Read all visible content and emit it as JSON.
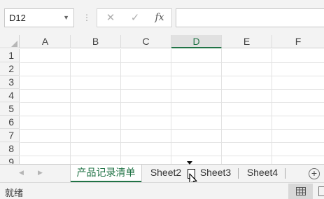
{
  "formula_bar": {
    "name_box": "D12",
    "cancel_icon": "✕",
    "enter_icon": "✓",
    "fx_label": "fx",
    "formula_value": ""
  },
  "grid": {
    "columns": [
      "A",
      "B",
      "C",
      "D",
      "E",
      "F"
    ],
    "rows": [
      "1",
      "2",
      "3",
      "4",
      "5",
      "6",
      "7",
      "8",
      "9"
    ],
    "selected_column": "D"
  },
  "sheet_tabs": {
    "tabs": [
      "产品记录清单",
      "Sheet2",
      "Sheet3",
      "Sheet4"
    ],
    "active_tab": "产品记录清单",
    "add_icon": "+"
  },
  "status_bar": {
    "status": "就绪"
  },
  "colors": {
    "accent": "#217346",
    "chrome": "#f3f3f3",
    "gridline": "#e2e2e2"
  }
}
